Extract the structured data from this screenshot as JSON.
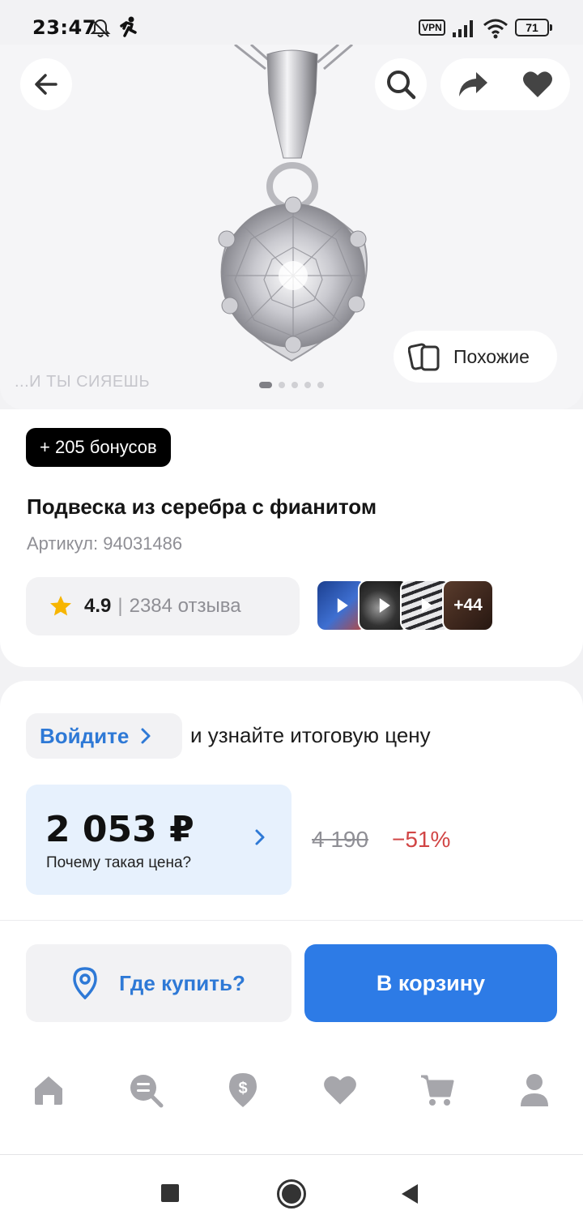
{
  "status_bar": {
    "time": "23:47",
    "vpn_label": "VPN",
    "battery": "71"
  },
  "hero": {
    "watermark": "...И ТЫ СИЯЕШЬ",
    "similar_label": "Похожие",
    "image_count": 5,
    "active_image": 0
  },
  "product": {
    "bonus": "+ 205 бонусов",
    "title": "Подвеска из серебра с фианитом",
    "sku": "Артикул: 94031486",
    "rating": "4.9",
    "separator": "|",
    "reviews": "2384 отзыва",
    "media_more": "+44"
  },
  "pricing": {
    "login_label": "Войдите",
    "login_hint": "и узнайте итоговую цену",
    "price": "2 053 ₽",
    "why_label": "Почему такая цена?",
    "old_price": "4 190",
    "discount": "−51%"
  },
  "actions": {
    "where_label": "Где купить?",
    "cart_label": "В корзину"
  },
  "colors": {
    "accent": "#2d7be6",
    "link": "#2e79d6",
    "discount": "#d14545",
    "price_bg": "#e7f1fd"
  }
}
